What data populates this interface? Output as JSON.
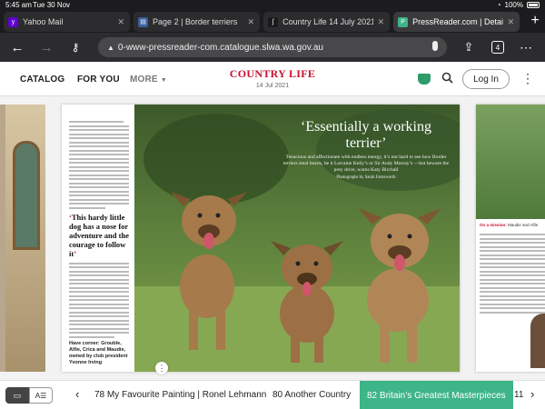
{
  "status": {
    "time": "5:45 am",
    "date": "Tue 30 Nov",
    "battery": "100%"
  },
  "tabs": [
    {
      "label": "Yahoo Mail",
      "color": "#6001d2",
      "icon": "yahoo-icon"
    },
    {
      "label": "Page 2 | Border terriers",
      "color": "#3b5fa0",
      "icon": "document-icon"
    },
    {
      "label": "Country Life 14 July 2021",
      "color": "#1a1a1a",
      "icon": "country-life-icon"
    },
    {
      "label": "PressReader.com | Detail",
      "color": "#3eb489",
      "icon": "pressreader-icon",
      "active": true
    }
  ],
  "address": {
    "url": "0-www-pressreader-com.catalogue.slwa.wa.gov.au",
    "tab_count": "4"
  },
  "site": {
    "catalog": "CATALOG",
    "for_you": "FOR YOU",
    "more": "MORE",
    "brand": "COUNTRY LIFE",
    "issue_date": "14 Jul 2021",
    "login": "Log In"
  },
  "article": {
    "headline": "‘Essentially a working terrier’",
    "standfirst": "Tenacious and affectionate with endless energy, it’s not hard to see how Border terriers steal hearts, be it Lorraine Kelly’s or Sir Andy Murray’s —but beware the prey drive, warns Katy Birchall",
    "byline": "Photographs by Sarah Farnsworth",
    "pull_quote": "This hardy little dog has a nose for adventure and the courage to follow it",
    "caption": "Have corner: Grouble, Alfie, Crica and Maudie, owned by club president Yvonne Irving"
  },
  "right_page": {
    "caption_lead": "On a mission:",
    "caption_rest": "Maudie and Alfie"
  },
  "bottom": {
    "prev_article": "78 My Favourite Painting | Ronel Lehmann",
    "article_2": "80 Another Country",
    "current_article": "82 Britain’s Greatest Masterpieces",
    "next_article": "11"
  },
  "colors": {
    "accent": "#3eb489",
    "brand_red": "#c8102e"
  }
}
